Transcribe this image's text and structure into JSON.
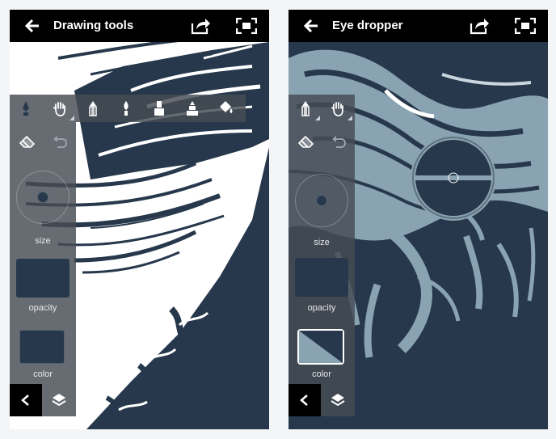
{
  "left_screen": {
    "title": "Drawing tools",
    "icons": {
      "back": "arrow-left-icon",
      "share": "share-icon",
      "fullscreen": "fullscreen-icon"
    },
    "tools": [
      {
        "name": "pen-nib-icon",
        "active": true
      },
      {
        "name": "hand-icon",
        "active": false
      },
      {
        "name": "pencil-icon",
        "active": false
      },
      {
        "name": "brush-icon",
        "active": false
      },
      {
        "name": "marker-icon",
        "active": false
      },
      {
        "name": "highlighter-icon",
        "active": false
      },
      {
        "name": "paint-bucket-icon",
        "active": false
      }
    ],
    "size_label": "size",
    "opacity_label": "opacity",
    "color_label": "color"
  },
  "right_screen": {
    "title": "Eye dropper",
    "size_label": "size",
    "opacity_label": "opacity",
    "color_label": "color"
  },
  "colors": {
    "ink": "#27384c",
    "light": "#8aa3b2",
    "topbar": "#000000",
    "panel": "#464c54"
  }
}
